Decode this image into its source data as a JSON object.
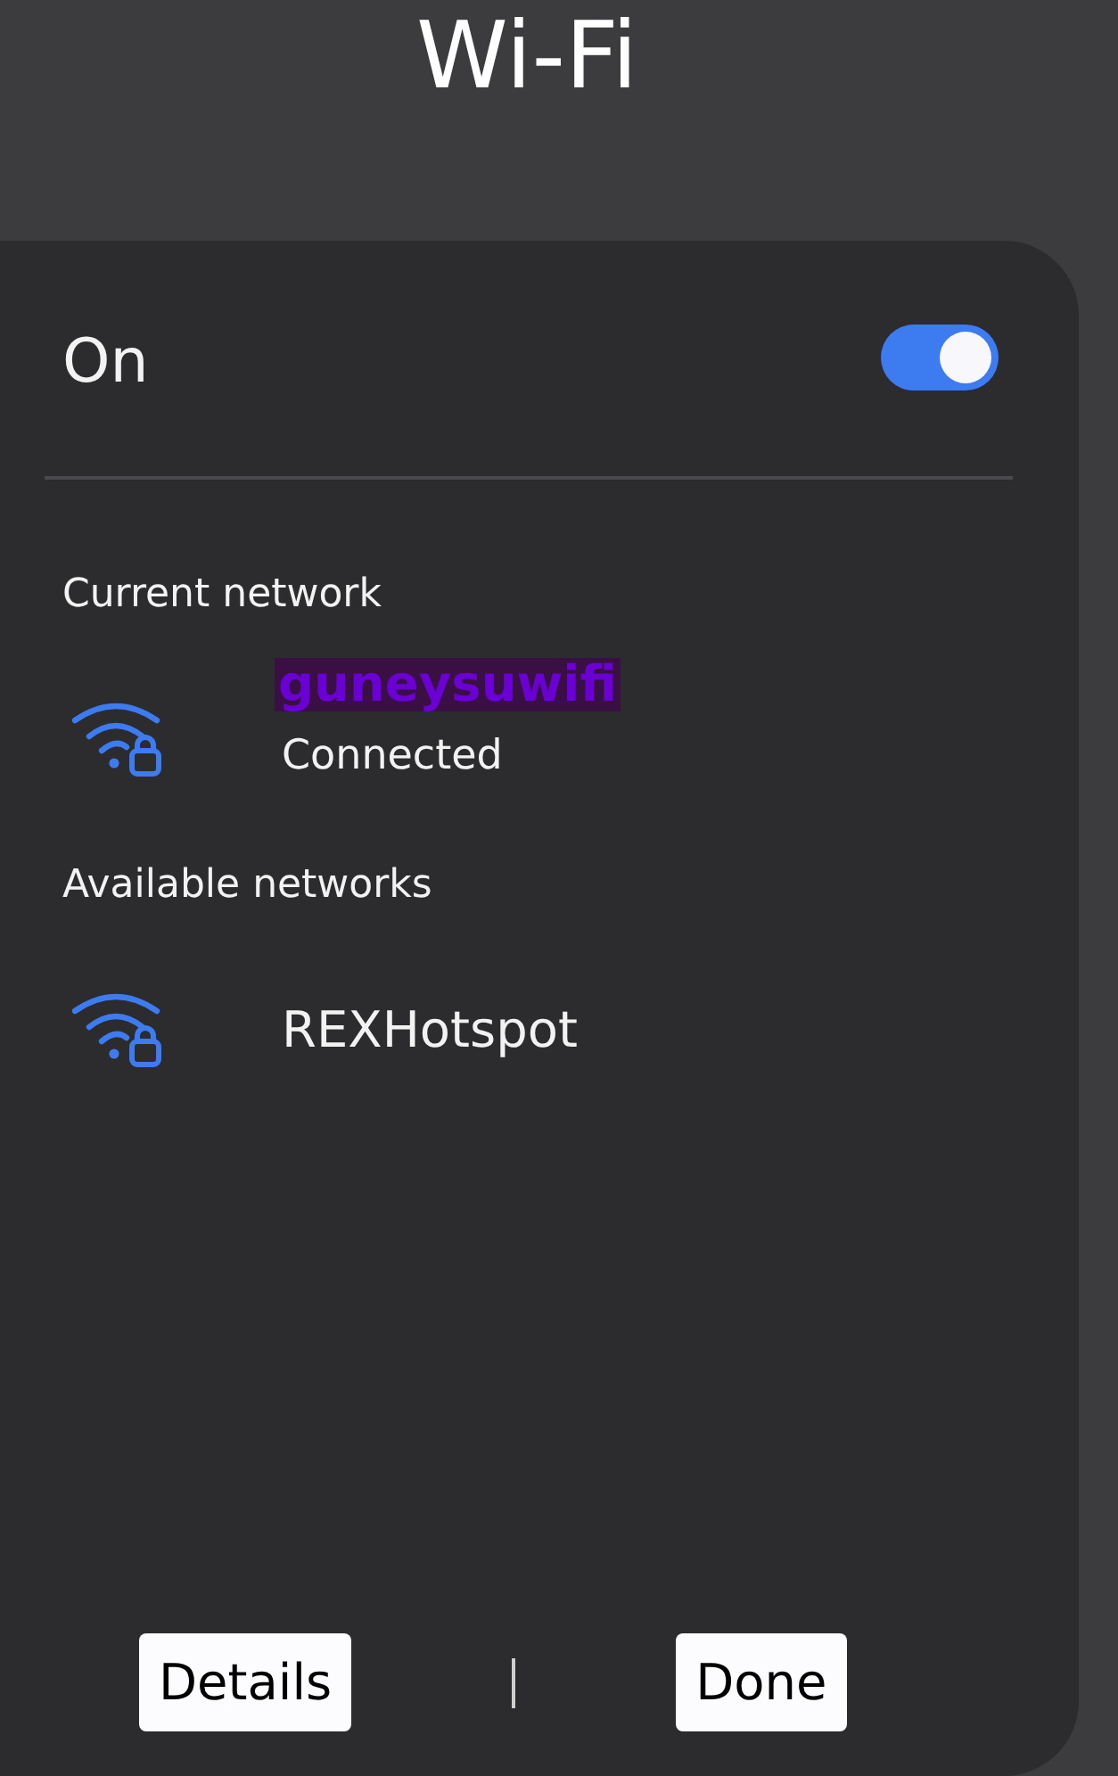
{
  "title": "Wi-Fi",
  "wifi": {
    "label": "On",
    "on": true
  },
  "sections": [
    {
      "heading": "Current network",
      "networks": [
        {
          "name": "guneysuwifi",
          "status": "Connected",
          "highlighted": true,
          "secured": true
        }
      ]
    },
    {
      "heading": "Available networks",
      "networks": [
        {
          "name": "REXHotspot",
          "highlighted": false,
          "secured": true
        }
      ]
    }
  ],
  "buttons": [
    {
      "label": "Details"
    },
    {
      "label": "Done"
    }
  ]
}
